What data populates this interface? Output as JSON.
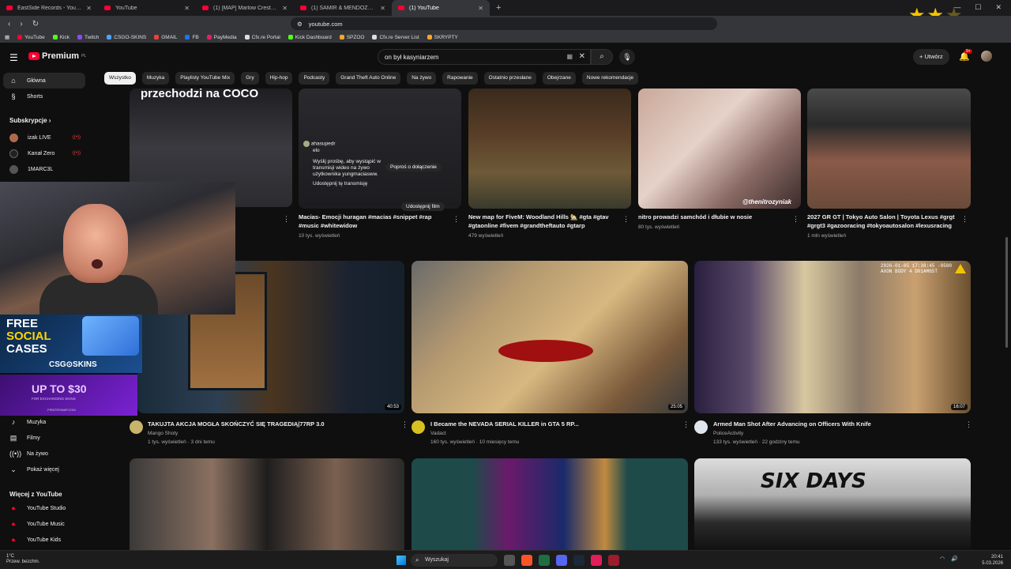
{
  "browser": {
    "tabs": [
      {
        "title": "EastSide Records - YouTube",
        "active": false
      },
      {
        "title": "YouTube",
        "active": false
      },
      {
        "title": "(1) [MAP] Marlow Crest Estate Mans",
        "active": false
      },
      {
        "title": "(1) SAMIR & MENDOZA - EZY (Offic",
        "active": false
      },
      {
        "title": "(1) YouTube",
        "active": true
      }
    ],
    "url": "youtube.com",
    "bookmarks": [
      "YouTube",
      "Kick",
      "Twitch",
      "CSGO-SKINS",
      "GMAIL",
      "FB",
      "PayMedia",
      "Cfx.re Portal",
      "Kick Dashboard",
      "SPZOO",
      "Cfx.re Server List",
      "SKRYPTY"
    ]
  },
  "youtube": {
    "logo_text": "Premium",
    "logo_region": "PL",
    "search_value": "on był kasyniarzem",
    "create_label": "Utwórz",
    "notification_count": "9+"
  },
  "sidebar": {
    "main": [
      {
        "label": "Główna",
        "icon": "home-icon",
        "active": true
      },
      {
        "label": "Shorts",
        "icon": "shorts-icon",
        "active": false
      }
    ],
    "subs_heading": "Subskrypcje",
    "subscriptions": [
      {
        "label": "izak LIVE",
        "live": true
      },
      {
        "label": "Kanał Zero",
        "live": true
      },
      {
        "label": "1MARC3L",
        "live": false
      }
    ],
    "explore": [
      {
        "label": "Muzyka",
        "icon": "music-icon"
      },
      {
        "label": "Filmy",
        "icon": "film-icon"
      },
      {
        "label": "Na żywo",
        "icon": "live-icon"
      },
      {
        "label": "Pokaż więcej",
        "icon": "chevron-down-icon"
      }
    ],
    "more_heading": "Więcej z YouTube",
    "more": [
      {
        "label": "YouTube Studio"
      },
      {
        "label": "YouTube Music"
      },
      {
        "label": "YouTube Kids"
      }
    ]
  },
  "chips": [
    "Wszystko",
    "Muzyka",
    "Playlisty YouTube Mix",
    "Gry",
    "Hip-hop",
    "Podcasty",
    "Grand Theft Auto Online",
    "Na żywo",
    "Rapowanie",
    "Ostatnio przesłane",
    "Obejrzane",
    "Nowe rekomendacje"
  ],
  "row1": [
    {
      "title": "przechodzi na COCO",
      "meta": ""
    },
    {
      "title": "Macias- Emocji huragan #macias #snippet #rap #music #whitewidow",
      "meta": "10 tys. wyświetleń"
    },
    {
      "title": "New map for FiveM: Woodland Hills 🏡 #gta #gtav #gtaonline #fivem #grandtheftauto #gtarp",
      "meta": "479 wyświetleń"
    },
    {
      "title": "nitro prowadzi samchód i dłubie w nosie",
      "meta": "80 tys. wyświetleń",
      "watermark": "@thenitrozyniak"
    },
    {
      "title": "2027 GR GT | Tokyo Auto Salon | Toyota Lexus #grgt #grgt3 #gazooracing #tokyoautosalon #lexusracing",
      "meta": "1 mln wyświetleń"
    }
  ],
  "overlay": {
    "comment_user": "ahasupedr",
    "comment_text": "elo",
    "request_text": "Wyślij prośbę, aby wystąpić w transmisji wideo na żywo użytkownika yungmaciasww.",
    "request_button": "Poproś o dołączenie",
    "share_text": "Udostępnij tę transmisję",
    "share_button": "Udostępnij film"
  },
  "row2": [
    {
      "title": "TAKUJTA AKCJA MOGŁA SKOŃCZYĆ SIĘ TRAGEDIĄ|77RP 3.0",
      "channel": "Mango Shoty",
      "meta": "1 tys. wyświetleń · 3 dni temu",
      "duration": "40:53"
    },
    {
      "title": "I Became the NEVADA SERIAL KILLER in GTA 5 RP...",
      "channel": "Vadact",
      "meta": "160 tys. wyświetleń · 10 miesięcy temu",
      "duration": "25:05"
    },
    {
      "title": "Armed Man Shot After Advancing on Officers With Knife",
      "channel": "PoliceActivity",
      "meta": "133 tys. wyświetleń · 22 godziny temu",
      "duration": "16:07",
      "bodycam": "2026-01-05 17:38:45 -0500 AXON BODY 4 D01AM65T"
    }
  ],
  "row3": [
    {
      "title": ""
    },
    {
      "title": ""
    },
    {
      "title": "SIX DAYS"
    }
  ],
  "ads": {
    "ad1_line1": "FREE",
    "ad1_line2": "SOCIAL",
    "ad1_line3": "CASES",
    "ad1_brand": "CSG⊙SKINS",
    "ad2_big": "UP TO $30",
    "ad2_small": "FOR EXCHANGING SKINS",
    "ad2_site": "PIRATESWAP.COM"
  },
  "taskbar": {
    "weather_temp": "1°C",
    "weather_desc": "Przew. bezchm.",
    "search_label": "Wyszukaj",
    "time": "20:41",
    "date": "5.03.2026"
  },
  "colors": {
    "bg": "#0f0f0f",
    "accent": "#ff0033",
    "chip": "#272727"
  }
}
